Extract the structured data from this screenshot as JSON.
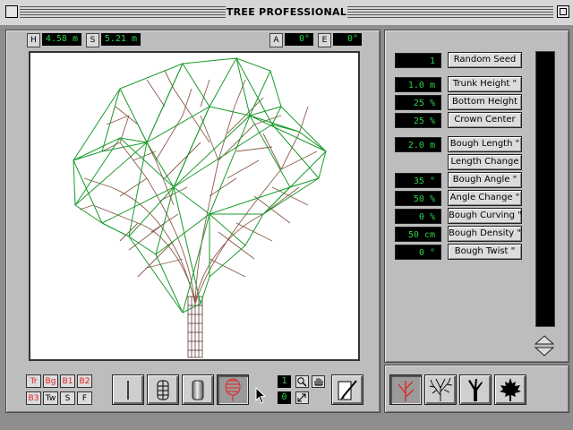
{
  "window": {
    "title": "TREE PROFESSIONAL"
  },
  "top_bar": {
    "h": {
      "label": "H",
      "value": "4.58 m"
    },
    "s": {
      "label": "S",
      "value": "5.21 m"
    },
    "a": {
      "label": "A",
      "value": "0°"
    },
    "e": {
      "label": "E",
      "value": "0°"
    }
  },
  "params": {
    "random_seed": {
      "value": "1",
      "label": "Random Seed"
    },
    "trunk_height": {
      "value": "1.0 m",
      "label": "Trunk Height \""
    },
    "bottom_height": {
      "value": "25 %",
      "label": "Bottom Height"
    },
    "crown_center": {
      "value": "25 %",
      "label": "Crown Center"
    },
    "bough_length": {
      "value": "2.0 m",
      "label": "Bough Length \""
    },
    "length_change": {
      "label": "Length Change"
    },
    "bough_angle": {
      "value": "35 °",
      "label": "Bough Angle \""
    },
    "angle_change": {
      "value": "50 %",
      "label": "Angle Change \""
    },
    "bough_curving": {
      "value": "0 %",
      "label": "Bough Curving \""
    },
    "bough_density": {
      "value": "50 cm",
      "label": "Bough Density \""
    },
    "bough_twist": {
      "value": "0 °",
      "label": "Bough Twist \""
    }
  },
  "layer_buttons": [
    "Tr",
    "Bg",
    "B1",
    "B2",
    "B3",
    "Tw",
    "S",
    "F"
  ],
  "layer_active": [
    true,
    true,
    true,
    true,
    true,
    false,
    false,
    false
  ],
  "counters": {
    "top": "1",
    "bottom": "0"
  },
  "icons": {
    "view_modes": [
      "line-icon",
      "wire-cylinder-icon",
      "solid-cylinder-icon",
      "leaf-crown-icon"
    ],
    "tree_types": [
      "red-branch-icon",
      "bare-tree-icon",
      "trunk-icon",
      "maple-leaf-icon"
    ]
  },
  "colors": {
    "lcd_text": "#2bd24a",
    "branch": "#8b5a4a",
    "crown_wire": "#1a9a2a",
    "accent_red": "#e52020"
  }
}
